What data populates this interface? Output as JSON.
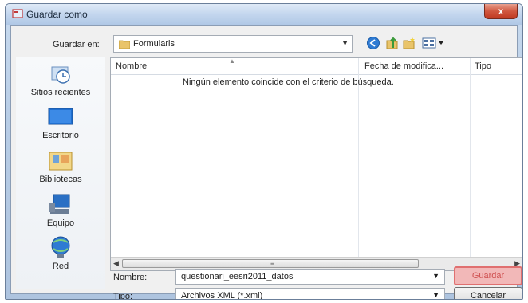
{
  "window": {
    "title": "Guardar como",
    "close_glyph": "x"
  },
  "location": {
    "label": "Guardar en:",
    "folder": "Formularis"
  },
  "toolbar": {
    "icons": [
      "back-icon",
      "up-folder-icon",
      "new-folder-icon",
      "views-icon"
    ]
  },
  "places": [
    {
      "label": "Sitios recientes",
      "icon": "recent-places-icon"
    },
    {
      "label": "Escritorio",
      "icon": "desktop-icon"
    },
    {
      "label": "Bibliotecas",
      "icon": "libraries-icon"
    },
    {
      "label": "Equipo",
      "icon": "computer-icon"
    },
    {
      "label": "Red",
      "icon": "network-icon"
    }
  ],
  "list": {
    "columns": [
      "Nombre",
      "Fecha de modifica...",
      "Tipo"
    ],
    "empty_message": "Ningún elemento coincide con el criterio de búsqueda."
  },
  "form": {
    "name_label": "Nombre:",
    "name_value": "questionari_eesri2011_datos",
    "type_label": "Tipo:",
    "type_value": "Archivos XML (*.xml)"
  },
  "buttons": {
    "save": "Guardar",
    "cancel": "Cancelar"
  },
  "colors": {
    "highlight": "#e07070",
    "title_bar": "#c3d6ee"
  }
}
